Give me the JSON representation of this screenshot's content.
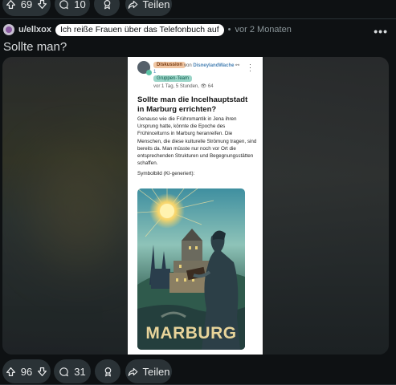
{
  "top_actions": {
    "upvotes": "69",
    "comments": "10",
    "share_label": "Teilen"
  },
  "post": {
    "username": "u/ellxox",
    "flair": "Ich reiße Frauen über das Telefonbuch auf",
    "separator": "•",
    "time": "vor 2 Monaten",
    "more": "•••",
    "title": "Sollte man?"
  },
  "screenshot_card": {
    "tag_discussion": "Diskussion",
    "by_prefix": "von",
    "author": "DisneylandWache",
    "author_badge": "1",
    "tag_group": "Gruppen-Team",
    "meta": "vor 1 Tag, 5 Stunden, 👁 64",
    "headline": "Sollte man die Incelhauptstadt in Marburg errichten?",
    "body": "Genauso wie die Frühromantik in Jena ihren Ursprung hatte, könnte die Epoche des Frühincelturns in Marburg heranreifen. Die Menschen, die diese kulturelle Strömung tragen, sind bereits da. Man müsste nur noch vor Ort die entsprechenden Strukturen und Begegnungsstätten schaffen.",
    "caption": "Symbolbild (KI-generiert):",
    "art_text": "MARBURG"
  },
  "bottom_actions": {
    "upvotes": "96",
    "comments": "31",
    "share_label": "Teilen"
  },
  "colors": {
    "background": "#0e1113",
    "pill": "#2a3236",
    "text": "#d7dadc",
    "muted": "#8a9599"
  },
  "icons": [
    "upvote-icon",
    "downvote-icon",
    "comment-icon",
    "award-icon",
    "share-icon",
    "more-icon"
  ]
}
